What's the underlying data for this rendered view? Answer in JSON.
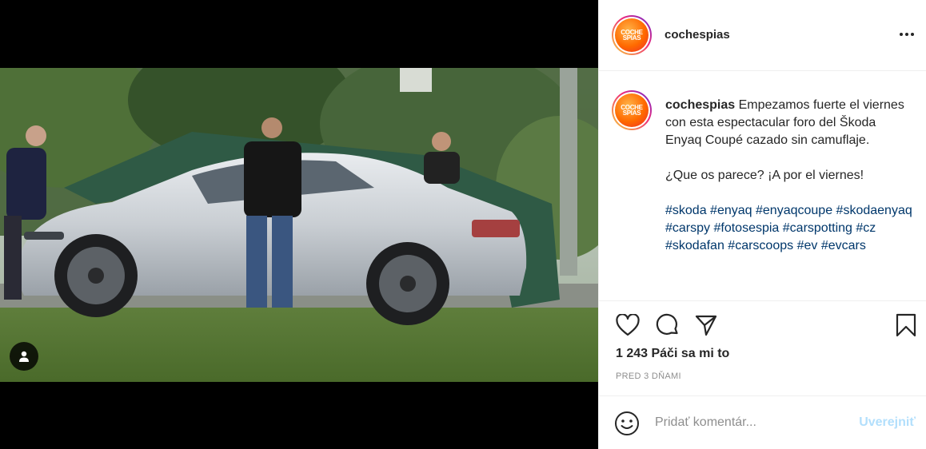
{
  "post": {
    "author": "cochespias",
    "avatar_text_line1": "COCHE",
    "avatar_text_line2": "SPIAS",
    "caption_username": "cochespias",
    "caption_line1": "Empezamos fuerte el viernes con esta espectacular foro del Škoda Enyaq Coupé cazado sin camuflaje.",
    "caption_line2": "¿Que os parece? ¡A por el viernes!",
    "hashtags": [
      "#skoda",
      "#enyaq",
      "#enyaqcoupe",
      "#skodaenyaq",
      "#carspy",
      "#fotosespia",
      "#carspotting",
      "#cz",
      "#skodafan",
      "#carscoops",
      "#ev",
      "#evcars"
    ],
    "likes": "1 243 Páči sa mi to",
    "timestamp": "PRED 3 DŇAMI"
  },
  "comment": {
    "placeholder": "Pridať komentár...",
    "post_label": "Uverejniť"
  },
  "icons": {
    "more": "more-options-icon",
    "like": "heart-icon",
    "comment": "comment-icon",
    "share": "paper-plane-icon",
    "save": "bookmark-icon",
    "emoji": "emoji-icon",
    "tag": "user-tag-icon"
  },
  "colors": {
    "hashtag": "#00376b",
    "muted": "#8e8e8e",
    "post_button_disabled": "#b2dffc"
  }
}
